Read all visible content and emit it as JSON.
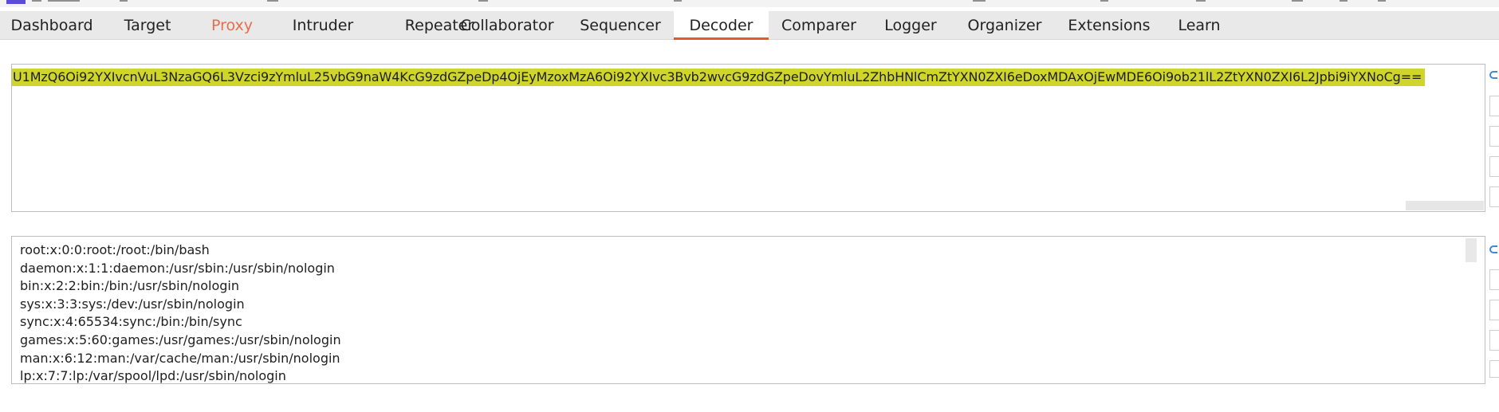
{
  "tabs": [
    {
      "label": "Dashboard",
      "state": "normal"
    },
    {
      "label": "Target",
      "state": "normal"
    },
    {
      "label": "Proxy",
      "state": "highlighted"
    },
    {
      "label": "Intruder",
      "state": "normal"
    },
    {
      "label": "Repeater",
      "state": "normal"
    },
    {
      "label": "Collaborator",
      "state": "normal"
    },
    {
      "label": "Sequencer",
      "state": "normal"
    },
    {
      "label": "Decoder",
      "state": "active"
    },
    {
      "label": "Comparer",
      "state": "normal"
    },
    {
      "label": "Logger",
      "state": "normal"
    },
    {
      "label": "Organizer",
      "state": "normal"
    },
    {
      "label": "Extensions",
      "state": "normal"
    },
    {
      "label": "Learn",
      "state": "normal"
    }
  ],
  "decoder": {
    "input_text": "U1MzQ6Oi92YXIvcnVuL3NzaGQ6L3Vzci9zYmluL25vbG9naW4KcG9zdGZpeDp4OjEyMzoxMzA6Oi92YXIvc3Bvb2wvcG9zdGZpeDovYmluL2ZhbHNlCmZtYXN0ZXI6eDoxMDAxOjEwMDE6Oi9ob21lL2ZtYXN0ZXI6L2Jpbi9iYXNoCg==",
    "output_lines": [
      "root:x:0:0:root:/root:/bin/bash",
      "daemon:x:1:1:daemon:/usr/sbin:/usr/sbin/nologin",
      "bin:x:2:2:bin:/bin:/usr/sbin/nologin",
      "sys:x:3:3:sys:/dev:/usr/sbin/nologin",
      "sync:x:4:65534:sync:/bin:/bin/sync",
      "games:x:5:60:games:/usr/games:/usr/sbin/nologin",
      "man:x:6:12:man:/var/cache/man:/usr/sbin/nologin",
      "lp:x:7:7:lp:/var/spool/lpd:/usr/sbin/nologin"
    ]
  },
  "colors": {
    "accent": "#e8562a",
    "proxy_tab_text": "#e86d4a",
    "selection_highlight": "#cfd52b",
    "tabbar_background": "#e9e9e9",
    "radio_accent": "#3a8ad8"
  }
}
